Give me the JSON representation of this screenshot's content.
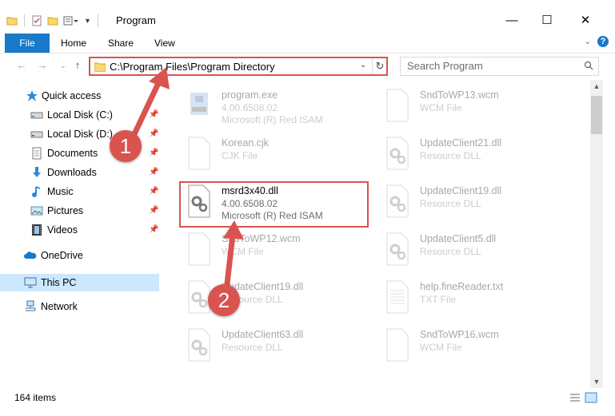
{
  "window": {
    "title": "Program",
    "controls": {
      "minimize": "—",
      "maximize": "☐",
      "close": "✕"
    }
  },
  "ribbon": {
    "file": "File",
    "tabs": [
      "Home",
      "Share",
      "View"
    ]
  },
  "address": {
    "path": "C:\\Program Files\\Program Directory"
  },
  "search": {
    "placeholder": "Search Program"
  },
  "sidebar": {
    "quick_access": "Quick access",
    "items": [
      {
        "label": "Local Disk (C:)",
        "icon": "drive-icon",
        "pinned": true
      },
      {
        "label": "Local Disk (D:)",
        "icon": "drive-icon",
        "pinned": true
      },
      {
        "label": "Documents",
        "icon": "documents-icon",
        "pinned": true
      },
      {
        "label": "Downloads",
        "icon": "downloads-icon",
        "pinned": true
      },
      {
        "label": "Music",
        "icon": "music-icon",
        "pinned": true
      },
      {
        "label": "Pictures",
        "icon": "pictures-icon",
        "pinned": true
      },
      {
        "label": "Videos",
        "icon": "videos-icon",
        "pinned": true
      }
    ],
    "onedrive": "OneDrive",
    "this_pc": "This PC",
    "network": "Network"
  },
  "files": [
    {
      "name": "program.exe",
      "meta1": "4.00.6508.02",
      "meta2": "Microsoft (R) Red ISAM",
      "icon": "exe-icon"
    },
    {
      "name": "SndToWP13.wcm",
      "meta1": "WCM File",
      "meta2": "",
      "icon": "blank-file-icon"
    },
    {
      "name": "Korean.cjk",
      "meta1": "CJK File",
      "meta2": "",
      "icon": "blank-file-icon"
    },
    {
      "name": "UpdateClient21.dll",
      "meta1": "Resource DLL",
      "meta2": "",
      "icon": "dll-gear-icon"
    },
    {
      "name": "msrd3x40.dll",
      "meta1": "4.00.6508.02",
      "meta2": "Microsoft (R) Red ISAM",
      "icon": "dll-gear-icon"
    },
    {
      "name": "UpdateClient19.dll",
      "meta1": "Resource DLL",
      "meta2": "",
      "icon": "dll-gear-icon"
    },
    {
      "name": "SndToWP12.wcm",
      "meta1": "WCM File",
      "meta2": "",
      "icon": "blank-file-icon"
    },
    {
      "name": "UpdateClient5.dll",
      "meta1": "Resource DLL",
      "meta2": "",
      "icon": "dll-gear-icon"
    },
    {
      "name": "UpdateClient19.dll",
      "meta1": "Resource DLL",
      "meta2": "",
      "icon": "dll-gear-icon"
    },
    {
      "name": "help.fineReader.txt",
      "meta1": "TXT File",
      "meta2": "",
      "icon": "text-file-icon"
    },
    {
      "name": "UpdateClient63.dll",
      "meta1": "Resource DLL",
      "meta2": "",
      "icon": "dll-gear-icon"
    },
    {
      "name": "SndToWP16.wcm",
      "meta1": "WCM File",
      "meta2": "",
      "icon": "blank-file-icon"
    }
  ],
  "status": {
    "count": "164 items"
  },
  "annotations": {
    "step1": "1",
    "step2": "2",
    "color": "#d9534f"
  }
}
